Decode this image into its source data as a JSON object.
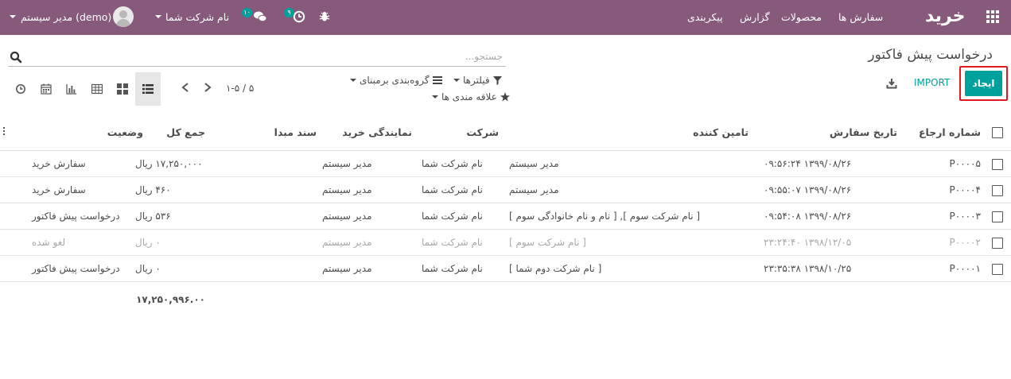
{
  "navbar": {
    "app_name": "خرید",
    "menu": [
      "سفارش ها",
      "محصولات",
      "گزارش",
      "پیکربندی"
    ],
    "company": "نام شرکت شما",
    "user": "مدیر سیستم (demo)",
    "messages_count": "۱۰",
    "activities_count": "۹"
  },
  "control_panel": {
    "title": "درخواست پیش فاکتور",
    "search_placeholder": "جستجو...",
    "create_label": "ایجاد",
    "import_label": "IMPORT",
    "filters_label": "فیلترها",
    "groupby_label": "گروه‌بندی برمبنای",
    "favorites_label": "علاقه مندی ها",
    "pager": "۱-۵ / ۵"
  },
  "table": {
    "headers": {
      "reference": "شماره ارجاع",
      "order_date": "تاریخ سفارش",
      "vendor": "تامین کننده",
      "company": "شرکت",
      "buyer": "نمایندگی خرید",
      "source": "سند مبدا",
      "total": "جمع کل",
      "status": "وضعیت"
    },
    "rows": [
      {
        "reference": "P۰۰۰۰۵",
        "order_date": "۱۳۹۹/۰۸/۲۶ ۰۹:۵۶:۲۴",
        "vendor": "مدیر سیستم",
        "company": "نام شرکت شما",
        "buyer": "مدیر سیستم",
        "source": "",
        "total": "۱۷,۲۵۰,۰۰۰ ریال",
        "status": "سفارش خرید"
      },
      {
        "reference": "P۰۰۰۰۴",
        "order_date": "۱۳۹۹/۰۸/۲۶ ۰۹:۵۵:۰۷",
        "vendor": "مدیر سیستم",
        "company": "نام شرکت شما",
        "buyer": "مدیر سیستم",
        "source": "",
        "total": "۴۶۰ ریال",
        "status": "سفارش خرید"
      },
      {
        "reference": "P۰۰۰۰۳",
        "order_date": "۱۳۹۹/۰۸/۲۶ ۰۹:۵۴:۰۸",
        "vendor": "[ نام شرکت سوم ], [ نام و نام خانوادگی سوم ]",
        "company": "نام شرکت شما",
        "buyer": "مدیر سیستم",
        "source": "",
        "total": "۵۳۶ ریال",
        "status": "درخواست پیش فاکتور"
      },
      {
        "reference": "P۰۰۰۰۲",
        "order_date": "۱۳۹۸/۱۲/۰۵ ۲۳:۲۴:۴۰",
        "vendor": "[ نام شرکت سوم ]",
        "company": "نام شرکت شما",
        "buyer": "مدیر سیستم",
        "source": "",
        "total": "۰ ریال",
        "status": "لغو شده"
      },
      {
        "reference": "P۰۰۰۰۱",
        "order_date": "۱۳۹۸/۱۰/۲۵ ۲۳:۳۵:۳۸",
        "vendor": "[ نام شرکت دوم شما ]",
        "company": "نام شرکت شما",
        "buyer": "مدیر سیستم",
        "source": "",
        "total": "۰ ریال",
        "status": "درخواست پیش فاکتور"
      }
    ],
    "grand_total": "۱۷,۲۵۰,۹۹۶.۰۰"
  },
  "colors": {
    "navbar": "#875a7b",
    "primary": "#00a09d",
    "highlight": "#e0191d"
  }
}
